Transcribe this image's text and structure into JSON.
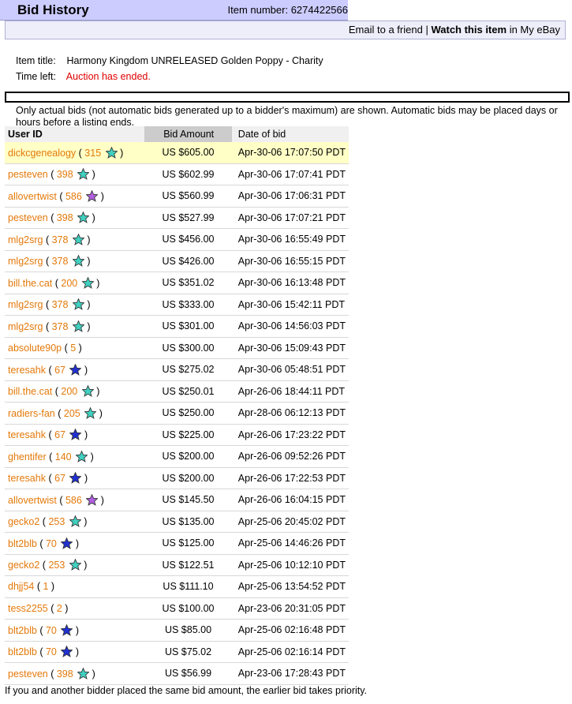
{
  "header": {
    "title": "Bid History",
    "item_number_label": "Item number: 6274422566"
  },
  "links": {
    "email_friend": "Email to a friend",
    "separator": "|",
    "watch": "Watch this item",
    "in_my_ebay": "in My eBay"
  },
  "item": {
    "title_label": "Item title:",
    "title_value": "Harmony Kingdom UNRELEASED Golden Poppy - Charity",
    "time_label": "Time left:",
    "time_value": "Auction has ended."
  },
  "note": "Only actual bids (not automatic bids generated up to a bidder's maximum) are shown. Automatic bids may be placed days or hours before a listing ends.",
  "table": {
    "headers": [
      "User ID",
      "Bid Amount",
      "Date of bid"
    ],
    "star_colors": {
      "turquoise": "#40d0c0",
      "purple": "#b060e0",
      "blue": "#2030d0"
    },
    "rows": [
      {
        "user": "dickcgenealogy",
        "feedback": "315",
        "star": "turquoise",
        "amount": "US $605.00",
        "date": "Apr-30-06 17:07:50 PDT"
      },
      {
        "user": "pesteven",
        "feedback": "398",
        "star": "turquoise",
        "amount": "US $602.99",
        "date": "Apr-30-06 17:07:41 PDT"
      },
      {
        "user": "allovertwist",
        "feedback": "586",
        "star": "purple",
        "amount": "US $560.99",
        "date": "Apr-30-06 17:06:31 PDT"
      },
      {
        "user": "pesteven",
        "feedback": "398",
        "star": "turquoise",
        "amount": "US $527.99",
        "date": "Apr-30-06 17:07:21 PDT"
      },
      {
        "user": "mlg2srg",
        "feedback": "378",
        "star": "turquoise",
        "amount": "US $456.00",
        "date": "Apr-30-06 16:55:49 PDT"
      },
      {
        "user": "mlg2srg",
        "feedback": "378",
        "star": "turquoise",
        "amount": "US $426.00",
        "date": "Apr-30-06 16:55:15 PDT"
      },
      {
        "user": "bill.the.cat",
        "feedback": "200",
        "star": "turquoise",
        "amount": "US $351.02",
        "date": "Apr-30-06 16:13:48 PDT"
      },
      {
        "user": "mlg2srg",
        "feedback": "378",
        "star": "turquoise",
        "amount": "US $333.00",
        "date": "Apr-30-06 15:42:11 PDT"
      },
      {
        "user": "mlg2srg",
        "feedback": "378",
        "star": "turquoise",
        "amount": "US $301.00",
        "date": "Apr-30-06 14:56:03 PDT"
      },
      {
        "user": "absolute90p",
        "feedback": "5",
        "star": "",
        "amount": "US $300.00",
        "date": "Apr-30-06 15:09:43 PDT"
      },
      {
        "user": "teresahk",
        "feedback": "67",
        "star": "blue",
        "amount": "US $275.02",
        "date": "Apr-30-06 05:48:51 PDT"
      },
      {
        "user": "bill.the.cat",
        "feedback": "200",
        "star": "turquoise",
        "amount": "US $250.01",
        "date": "Apr-26-06 18:44:11 PDT"
      },
      {
        "user": "radiers-fan",
        "feedback": "205",
        "star": "turquoise",
        "amount": "US $250.00",
        "date": "Apr-28-06 06:12:13 PDT"
      },
      {
        "user": "teresahk",
        "feedback": "67",
        "star": "blue",
        "amount": "US $225.00",
        "date": "Apr-26-06 17:23:22 PDT"
      },
      {
        "user": "ghentifer",
        "feedback": "140",
        "star": "turquoise",
        "amount": "US $200.00",
        "date": "Apr-26-06 09:52:26 PDT"
      },
      {
        "user": "teresahk",
        "feedback": "67",
        "star": "blue",
        "amount": "US $200.00",
        "date": "Apr-26-06 17:22:53 PDT"
      },
      {
        "user": "allovertwist",
        "feedback": "586",
        "star": "purple",
        "amount": "US $145.50",
        "date": "Apr-26-06 16:04:15 PDT"
      },
      {
        "user": "gecko2",
        "feedback": "253",
        "star": "turquoise",
        "amount": "US $135.00",
        "date": "Apr-25-06 20:45:02 PDT"
      },
      {
        "user": "blt2blb",
        "feedback": "70",
        "star": "blue",
        "amount": "US $125.00",
        "date": "Apr-25-06 14:46:26 PDT"
      },
      {
        "user": "gecko2",
        "feedback": "253",
        "star": "turquoise",
        "amount": "US $122.51",
        "date": "Apr-25-06 10:12:10 PDT"
      },
      {
        "user": "dhjj54",
        "feedback": "1",
        "star": "",
        "amount": "US $111.10",
        "date": "Apr-25-06 13:54:52 PDT"
      },
      {
        "user": "tess2255",
        "feedback": "2",
        "star": "",
        "amount": "US $100.00",
        "date": "Apr-23-06 20:31:05 PDT"
      },
      {
        "user": "blt2blb",
        "feedback": "70",
        "star": "blue",
        "amount": "US $85.00",
        "date": "Apr-25-06 02:16:48 PDT"
      },
      {
        "user": "blt2blb",
        "feedback": "70",
        "star": "blue",
        "amount": "US $75.02",
        "date": "Apr-25-06 02:16:14 PDT"
      },
      {
        "user": "pesteven",
        "feedback": "398",
        "star": "turquoise",
        "amount": "US $56.99",
        "date": "Apr-23-06 17:28:43 PDT"
      }
    ]
  },
  "footer": "If you and another bidder placed the same bid amount, the earlier bid takes priority."
}
